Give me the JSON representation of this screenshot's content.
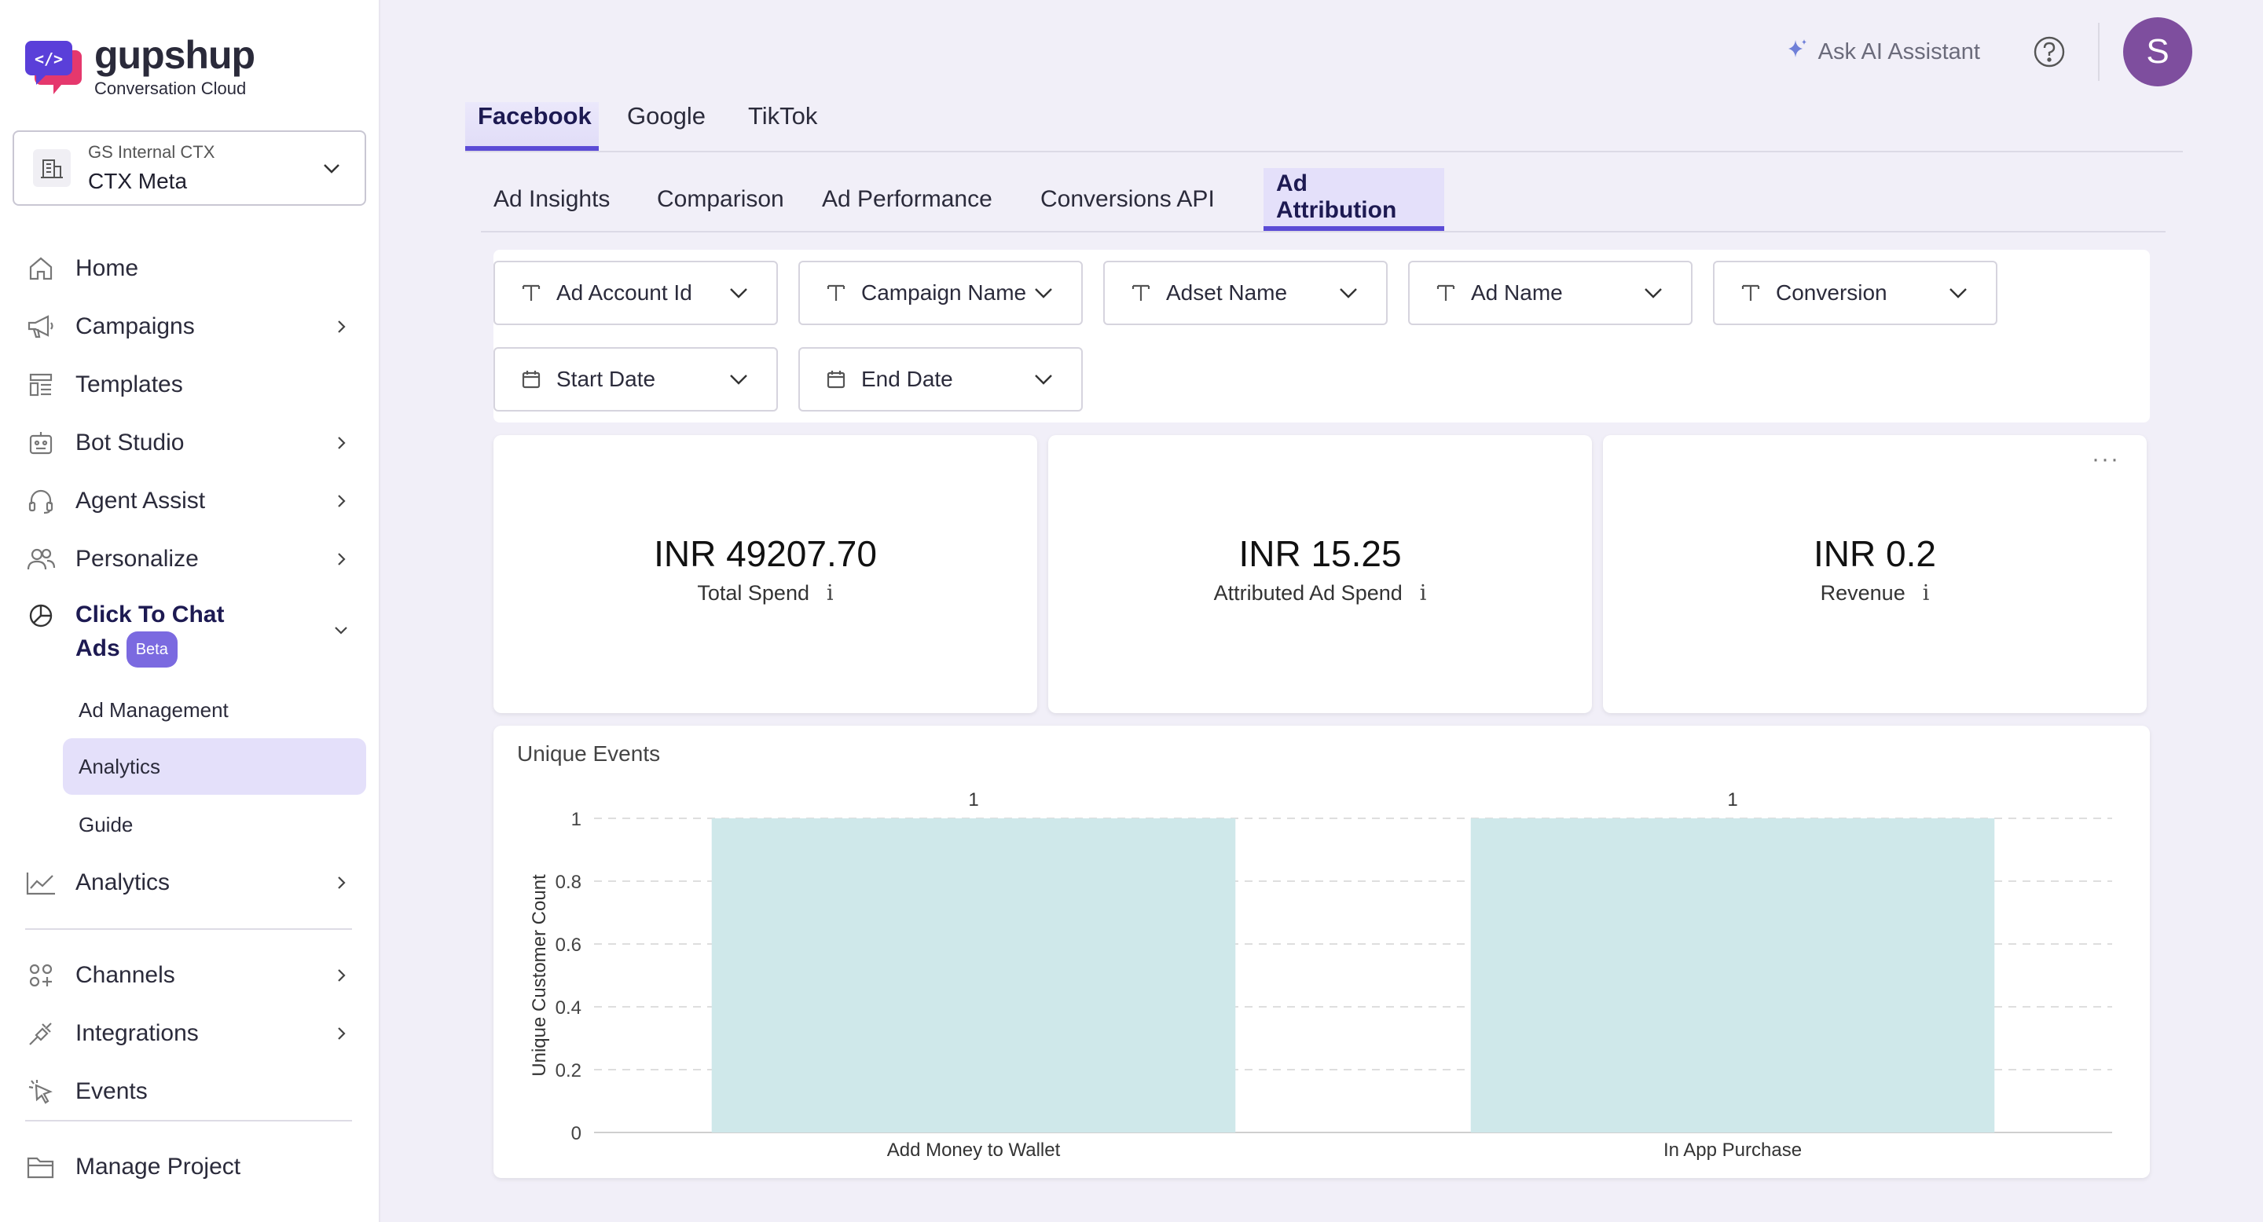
{
  "brand": {
    "name": "gupshup",
    "tagline": "Conversation Cloud"
  },
  "project": {
    "org": "GS Internal CTX",
    "name": "CTX Meta"
  },
  "sidebar": {
    "items": [
      {
        "label": "Home",
        "icon": "home-icon"
      },
      {
        "label": "Campaigns",
        "icon": "megaphone-icon"
      },
      {
        "label": "Templates",
        "icon": "templates-icon"
      },
      {
        "label": "Bot Studio",
        "icon": "bot-icon"
      },
      {
        "label": "Agent Assist",
        "icon": "headset-icon"
      },
      {
        "label": "Personalize",
        "icon": "users-icon"
      }
    ],
    "ctc": {
      "label_line1": "Click To Chat",
      "label_line2": "Ads",
      "badge": "Beta"
    },
    "sub_items": [
      "Ad Management",
      "Analytics",
      "Guide"
    ],
    "analytics": "Analytics",
    "lower_items": [
      {
        "label": "Channels",
        "icon": "channels-icon"
      },
      {
        "label": "Integrations",
        "icon": "plug-icon"
      },
      {
        "label": "Events",
        "icon": "cursor-icon"
      }
    ],
    "manage_project": "Manage Project"
  },
  "header": {
    "ask_ai": "Ask AI Assistant",
    "avatar_initial": "S"
  },
  "platform_tabs": [
    "Facebook",
    "Google",
    "TikTok"
  ],
  "report_tabs": [
    "Ad Insights",
    "Comparison",
    "Ad Performance",
    "Conversions API",
    "Ad Attribution"
  ],
  "filters": [
    "Ad Account Id",
    "Campaign Name",
    "Adset Name",
    "Ad Name",
    "Conversion",
    "Start Date",
    "End Date"
  ],
  "kpis": [
    {
      "value": "INR 49207.70",
      "label": "Total Spend",
      "info": "i"
    },
    {
      "value": "INR 15.25",
      "label": "Attributed Ad Spend",
      "info": "i"
    },
    {
      "value": "INR 0.2",
      "label": "Revenue",
      "info": "i"
    }
  ],
  "kpi_more": "···",
  "colors": {
    "accent": "#5b4bd6",
    "bar": "#cfe8ea",
    "avatar": "#7e4e9e"
  },
  "chart_data": {
    "type": "bar",
    "title": "Unique Events",
    "categories": [
      "Add Money to Wallet",
      "In App Purchase"
    ],
    "values": [
      1,
      1
    ],
    "data_labels": [
      "1",
      "1"
    ],
    "xlabel": "",
    "ylabel": "Unique Customer Count",
    "ylim": [
      0,
      1
    ],
    "yticks": [
      "0",
      "0.2",
      "0.4",
      "0.6",
      "0.8",
      "1"
    ],
    "grid": true
  }
}
